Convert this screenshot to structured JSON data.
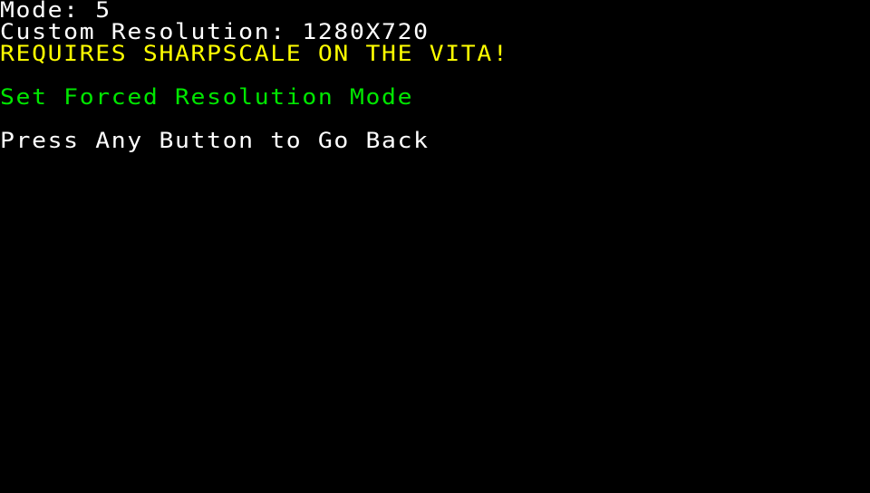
{
  "screen": {
    "mode_line": "Mode: 5",
    "resolution_line": "Custom Resolution: 1280X720",
    "warning_line": "REQUIRES SHARPSCALE ON THE VITA!",
    "action_line": "Set Forced Resolution Mode",
    "back_prompt": "Press Any Button to Go Back"
  },
  "colors": {
    "background": "#000000",
    "text": "#ffffff",
    "warning": "#ffff00",
    "action": "#00e600"
  }
}
